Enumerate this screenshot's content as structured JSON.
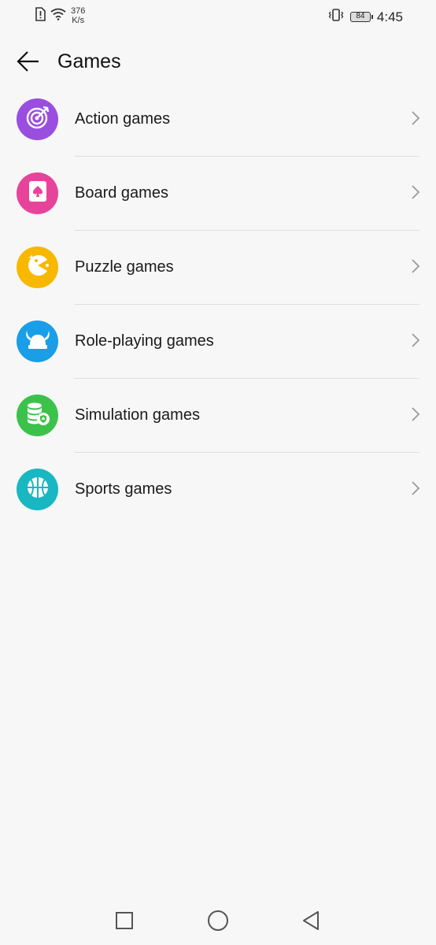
{
  "status_bar": {
    "speed_value": "376",
    "speed_unit": "K/s",
    "battery_level": "84",
    "time": "4:45",
    "icons": [
      "alert-sim-icon",
      "wifi-icon",
      "vibrate-icon",
      "battery-icon"
    ]
  },
  "header": {
    "back_icon": "arrow-left-icon",
    "title": "Games"
  },
  "categories": [
    {
      "label": "Action games",
      "color": "#9a4ee0",
      "icon": "target-icon"
    },
    {
      "label": "Board games",
      "color": "#e8439a",
      "icon": "card-spade-icon"
    },
    {
      "label": "Puzzle games",
      "color": "#f9b800",
      "icon": "pacman-icon"
    },
    {
      "label": "Role-playing games",
      "color": "#1a9ee8",
      "icon": "viking-helmet-icon"
    },
    {
      "label": "Simulation games",
      "color": "#3cc24b",
      "icon": "database-shield-icon"
    },
    {
      "label": "Sports games",
      "color": "#18b7c2",
      "icon": "basketball-icon"
    }
  ],
  "nav_bar": {
    "icons": [
      "recent-apps-square-icon",
      "home-circle-icon",
      "back-triangle-icon"
    ]
  }
}
